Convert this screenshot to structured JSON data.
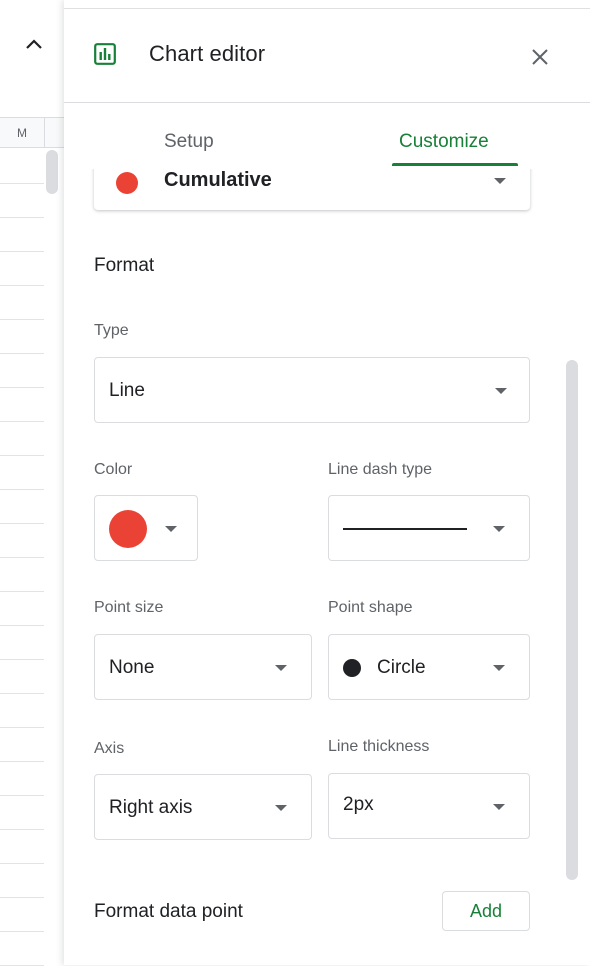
{
  "sheet": {
    "column_header": "M",
    "row_count": 24
  },
  "editor": {
    "title": "Chart editor",
    "icons": {
      "chart": "bar-chart-icon",
      "close": "close-icon",
      "collapse": "chevron-up-icon"
    },
    "tabs": [
      {
        "label": "Setup",
        "active": false
      },
      {
        "label": "Customize",
        "active": true
      }
    ],
    "series": {
      "label": "Cumulative",
      "color": "#ea4335"
    },
    "format": {
      "section_title": "Format",
      "type_label": "Type",
      "type_value": "Line",
      "color_label": "Color",
      "color_value": "#ea4335",
      "line_dash_label": "Line dash type",
      "line_dash_value": "solid",
      "point_size_label": "Point size",
      "point_size_value": "None",
      "point_shape_label": "Point shape",
      "point_shape_value": "Circle",
      "axis_label": "Axis",
      "axis_value": "Right axis",
      "line_thickness_label": "Line thickness",
      "line_thickness_value": "2px"
    },
    "format_data_point": {
      "title": "Format data point",
      "add_label": "Add"
    },
    "colors": {
      "accent": "#188038",
      "muted_text": "#5f6368",
      "border": "#dadce0"
    }
  }
}
